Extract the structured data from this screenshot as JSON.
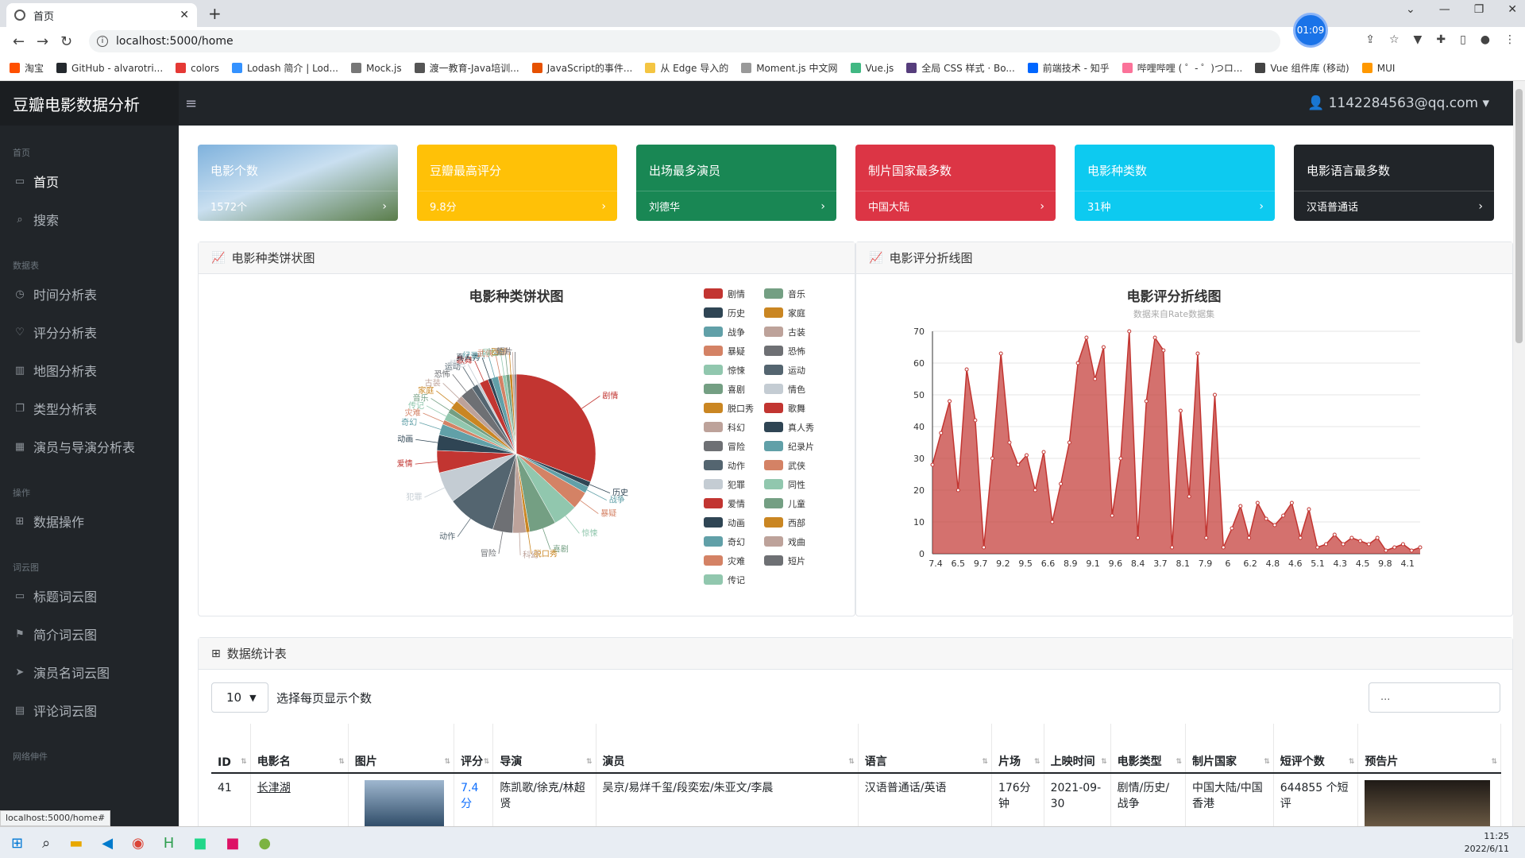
{
  "browser": {
    "tab_title": "首页",
    "url": "localhost:5000/home",
    "rec_time": "01:09",
    "bookmarks": [
      {
        "label": "淘宝",
        "color": "#ff5000"
      },
      {
        "label": "GitHub - alvarotri...",
        "color": "#24292e"
      },
      {
        "label": "colors",
        "color": "#e53935"
      },
      {
        "label": "Lodash 简介 | Lod...",
        "color": "#3492ff"
      },
      {
        "label": "Mock.js",
        "color": "#777777"
      },
      {
        "label": "渡一教育-Java培训...",
        "color": "#555555"
      },
      {
        "label": "JavaScript的事件...",
        "color": "#e65100"
      },
      {
        "label": "从 Edge 导入的",
        "color": "#f4c542"
      },
      {
        "label": "Moment.js 中文网",
        "color": "#999999"
      },
      {
        "label": "Vue.js",
        "color": "#41b883"
      },
      {
        "label": "全局 CSS 样式 · Bo...",
        "color": "#563d7c"
      },
      {
        "label": "前端技术 - 知乎",
        "color": "#0066ff"
      },
      {
        "label": "哔哩哔哩 ( ゜- ゜)つロ...",
        "color": "#fb7299"
      },
      {
        "label": "Vue 组件库 (移动)",
        "color": "#444444"
      },
      {
        "label": "MUI",
        "color": "#ff9800"
      }
    ],
    "status_url": "localhost:5000/home#"
  },
  "app": {
    "brand": "豆瓣电影数据分析",
    "user": "1142284563@qq.com",
    "sidebar": [
      {
        "type": "head",
        "label": "首页"
      },
      {
        "type": "item",
        "label": "首页",
        "icon": "monitor-icon",
        "active": true
      },
      {
        "type": "item",
        "label": "搜索",
        "icon": "search-icon"
      },
      {
        "type": "head",
        "label": "数据表"
      },
      {
        "type": "item",
        "label": "时间分析表",
        "icon": "clock-icon"
      },
      {
        "type": "item",
        "label": "评分分析表",
        "icon": "heart-icon"
      },
      {
        "type": "item",
        "label": "地图分析表",
        "icon": "map-icon"
      },
      {
        "type": "item",
        "label": "类型分析表",
        "icon": "copy-icon"
      },
      {
        "type": "item",
        "label": "演员与导演分析表",
        "icon": "building-icon"
      },
      {
        "type": "head",
        "label": "操作"
      },
      {
        "type": "item",
        "label": "数据操作",
        "icon": "table-icon"
      },
      {
        "type": "head",
        "label": "词云图"
      },
      {
        "type": "item",
        "label": "标题词云图",
        "icon": "comment-icon"
      },
      {
        "type": "item",
        "label": "简介词云图",
        "icon": "flag-icon"
      },
      {
        "type": "item",
        "label": "演员名词云图",
        "icon": "send-icon"
      },
      {
        "type": "item",
        "label": "评论词云图",
        "icon": "list-icon"
      },
      {
        "type": "head",
        "label": "网络伸件"
      }
    ],
    "cards": [
      {
        "title": "电影个数",
        "value": "1572个",
        "color": "#5b8db8"
      },
      {
        "title": "豆瓣最高评分",
        "value": "9.8分",
        "color": "#ffc107"
      },
      {
        "title": "出场最多演员",
        "value": "刘德华",
        "color": "#198754"
      },
      {
        "title": "制片国家最多数",
        "value": "中国大陆",
        "color": "#dc3545"
      },
      {
        "title": "电影种类数",
        "value": "31种",
        "color": "#0dcaf0"
      },
      {
        "title": "电影语言最多数",
        "value": "汉语普通话",
        "color": "#212529"
      }
    ],
    "pie_panel_title": "电影种类饼状图",
    "line_panel_title": "电影评分折线图",
    "table_panel_title": "数据统计表",
    "page_size": "10",
    "page_size_label": "选择每页显示个数",
    "search_placeholder": "...",
    "table": {
      "headers": [
        "ID",
        "电影名",
        "图片",
        "评分",
        "导演",
        "演员",
        "语言",
        "片场",
        "上映时间",
        "电影类型",
        "制片国家",
        "短评个数",
        "预告片"
      ],
      "rows": [
        [
          "41",
          "长津湖",
          "",
          "7.4分",
          "陈凯歌/徐克/林超贤",
          "吴京/易烊千玺/段奕宏/朱亚文/李晨",
          "汉语普通话/英语",
          "176分钟",
          "2021-09-30",
          "剧情/历史/战争",
          "中国大陆/中国香港",
          "644855 个短评",
          ""
        ]
      ]
    }
  },
  "chart_data": [
    {
      "type": "pie",
      "title": "电影种类饼状图",
      "categories": [
        "剧情",
        "历史",
        "战争",
        "暴疑",
        "惊悚",
        "喜剧",
        "脱口秀",
        "科幻",
        "冒险",
        "动作",
        "犯罪",
        "爱情",
        "动画",
        "奇幻",
        "灾难",
        "传记",
        "音乐",
        "家庭",
        "古装",
        "恐怖",
        "运动",
        "情色",
        "歌舞",
        "真人秀",
        "纪录片",
        "武侠",
        "同性",
        "儿童",
        "西部",
        "戏曲",
        "短片"
      ],
      "values": [
        340,
        12,
        15,
        40,
        55,
        60,
        8,
        30,
        45,
        110,
        70,
        50,
        35,
        25,
        10,
        18,
        12,
        20,
        15,
        30,
        14,
        6,
        20,
        8,
        15,
        10,
        8,
        8,
        6,
        5,
        4
      ],
      "colors": [
        "#c23531",
        "#2f4554",
        "#61a0a8",
        "#d48265",
        "#91c7ae",
        "#749f83",
        "#ca8622",
        "#bda29a",
        "#6e7074",
        "#546570",
        "#c4ccd3",
        "#c23531",
        "#2f4554",
        "#61a0a8",
        "#d48265",
        "#91c7ae",
        "#749f83",
        "#ca8622",
        "#bda29a",
        "#6e7074",
        "#546570",
        "#c4ccd3",
        "#c23531",
        "#2f4554",
        "#61a0a8",
        "#d48265",
        "#91c7ae",
        "#749f83",
        "#ca8622",
        "#bda29a",
        "#6e7074"
      ]
    },
    {
      "type": "area",
      "title": "电影评分折线图",
      "subtitle": "数据来自Rate数据集",
      "x_ticks": [
        "7.4",
        "6.5",
        "9.7",
        "9.2",
        "9.5",
        "6.6",
        "8.9",
        "9.1",
        "9.6",
        "8.4",
        "3.7",
        "8.1",
        "7.9",
        "6",
        "6.2",
        "4.8",
        "4.6",
        "5.1",
        "4.3",
        "4.5",
        "9.8",
        "4.1"
      ],
      "values": [
        28,
        38,
        48,
        20,
        58,
        42,
        2,
        30,
        63,
        35,
        28,
        31,
        20,
        32,
        10,
        22,
        35,
        60,
        68,
        55,
        65,
        12,
        30,
        70,
        5,
        48,
        68,
        64,
        2,
        45,
        18,
        63,
        5,
        50,
        2,
        8,
        15,
        5,
        16,
        11,
        9,
        12,
        16,
        5,
        14,
        2,
        3,
        6,
        3,
        5,
        4,
        3,
        5,
        1,
        2,
        3,
        1,
        2
      ],
      "ylim": [
        0,
        70
      ],
      "y_ticks": [
        0,
        10,
        20,
        30,
        40,
        50,
        60,
        70
      ],
      "color": "#c23531"
    }
  ]
}
